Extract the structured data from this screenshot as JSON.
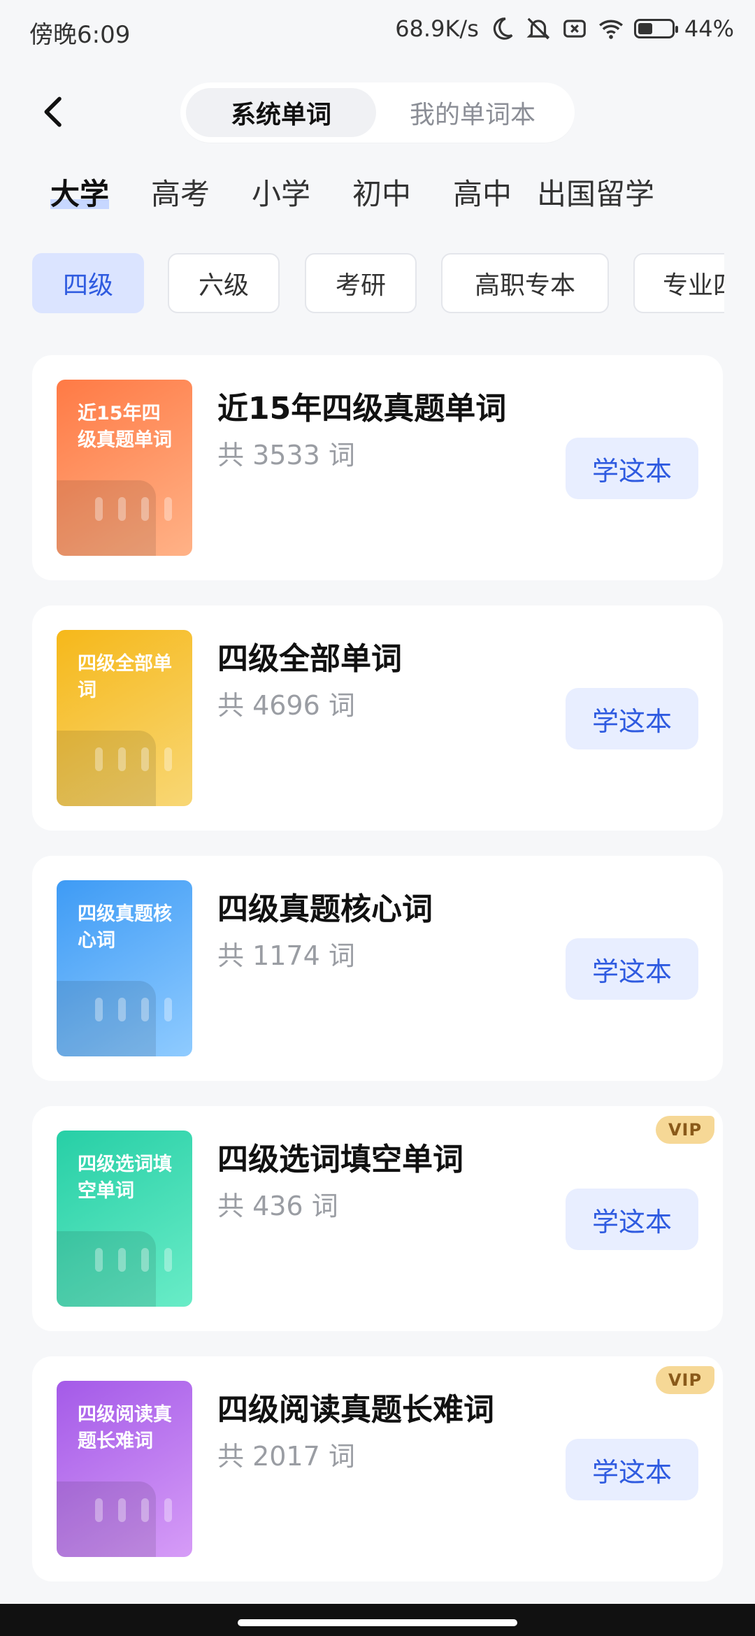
{
  "status": {
    "time": "傍晚6:09",
    "net_speed": "68.9K/s",
    "battery": "44%",
    "battery_level": 0.44,
    "icons": [
      "moon-icon",
      "mute-bell-icon",
      "sim-x-icon",
      "wifi-icon",
      "battery-icon"
    ]
  },
  "header": {
    "back_icon": "back-chevron-icon",
    "tabs": [
      "系统单词",
      "我的单词本"
    ],
    "active_tab": 0
  },
  "levels": {
    "items": [
      "大学",
      "高考",
      "小学",
      "初中",
      "高中",
      "出国留学"
    ],
    "active": 0
  },
  "chips": {
    "items": [
      "四级",
      "六级",
      "考研",
      "高职专本",
      "专业四"
    ],
    "active": 0
  },
  "books": [
    {
      "cover_text": "近15年四级真题单词",
      "title": "近15年四级真题单词",
      "count": "共 3533 词",
      "button": "学这本",
      "vip": "",
      "color_from": "#ff7a45",
      "color_to": "#ffb287"
    },
    {
      "cover_text": "四级全部单词",
      "title": "四级全部单词",
      "count": "共 4696 词",
      "button": "学这本",
      "vip": "",
      "color_from": "#f6b81a",
      "color_to": "#f8d775"
    },
    {
      "cover_text": "四级真题核心词",
      "title": "四级真题核心词",
      "count": "共 1174 词",
      "button": "学这本",
      "vip": "",
      "color_from": "#3e9bf5",
      "color_to": "#8fcbff"
    },
    {
      "cover_text": "四级选词填空单词",
      "title": "四级选词填空单词",
      "count": "共 436 词",
      "button": "学这本",
      "vip": "VIP",
      "color_from": "#27cfa6",
      "color_to": "#69ecc7"
    },
    {
      "cover_text": "四级阅读真题长难词",
      "title": "四级阅读真题长难词",
      "count": "共 2017 词",
      "button": "学这本",
      "vip": "VIP",
      "color_from": "#a45ae8",
      "color_to": "#d69cf7"
    }
  ]
}
